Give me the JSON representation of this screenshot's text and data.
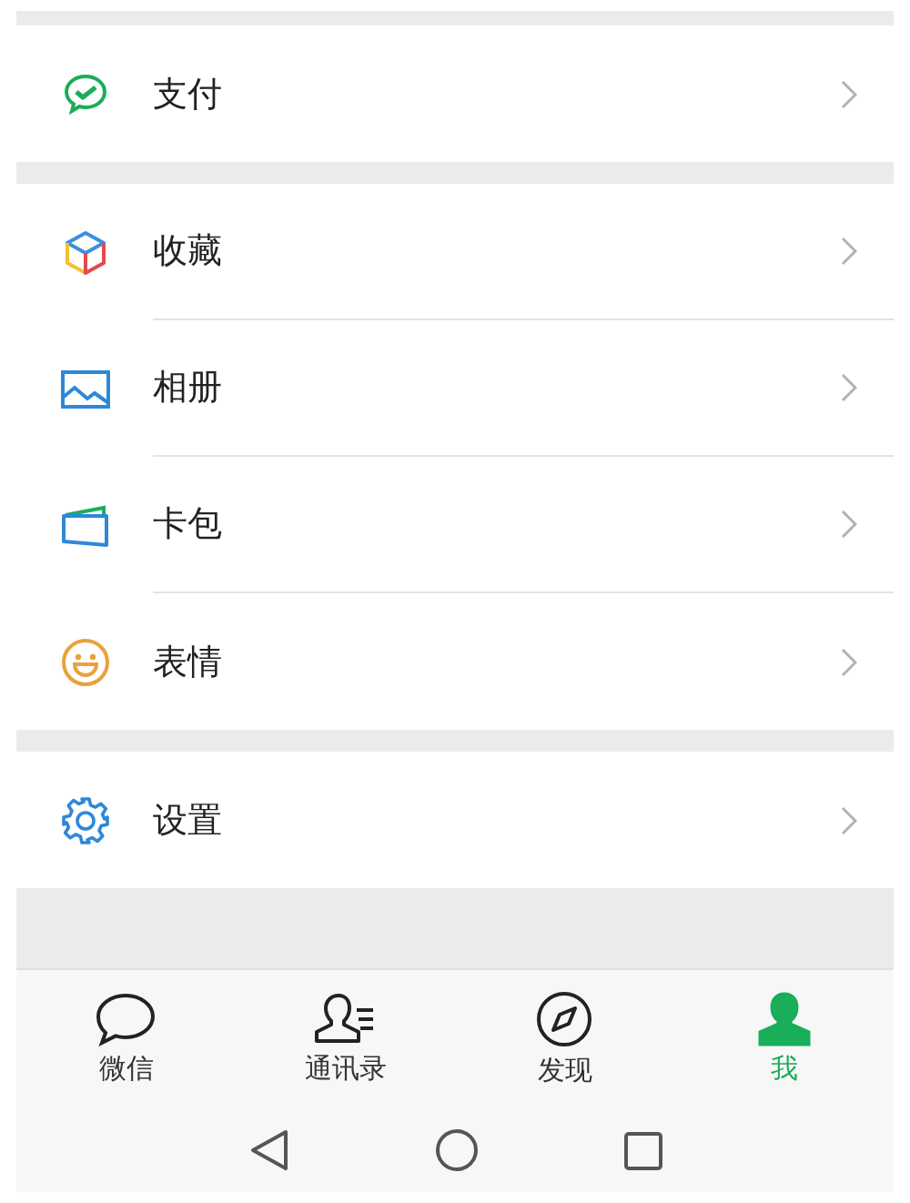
{
  "groups": [
    {
      "items": [
        {
          "label": "支付"
        }
      ]
    },
    {
      "items": [
        {
          "label": "收藏"
        },
        {
          "label": "相册"
        },
        {
          "label": "卡包"
        },
        {
          "label": "表情"
        }
      ]
    },
    {
      "items": [
        {
          "label": "设置"
        }
      ]
    }
  ],
  "tabs": [
    {
      "label": "微信",
      "selected": false
    },
    {
      "label": "通讯录",
      "selected": false
    },
    {
      "label": "发现",
      "selected": false
    },
    {
      "label": "我",
      "selected": true
    }
  ]
}
